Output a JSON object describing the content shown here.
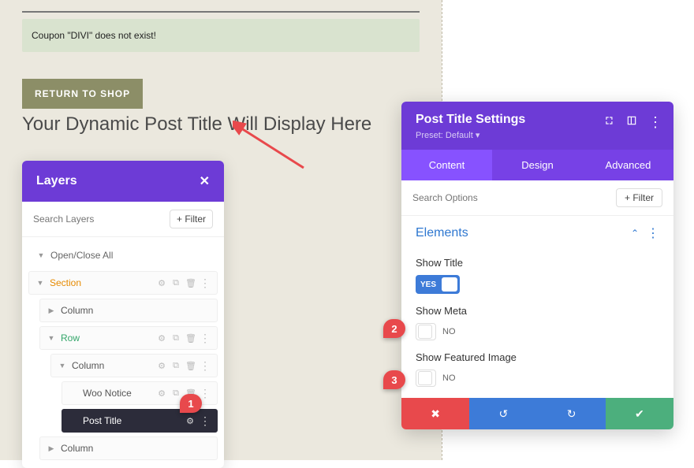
{
  "page": {
    "notice_text": "Coupon \"DIVI\" does not exist!",
    "return_button": "RETURN TO SHOP",
    "dynamic_title": "Your Dynamic Post Title Will Display Here"
  },
  "layers_panel": {
    "title": "Layers",
    "search_placeholder": "Search Layers",
    "filter_label": "+ Filter",
    "open_close": "Open/Close All",
    "tree": {
      "section": "Section",
      "column1": "Column",
      "row": "Row",
      "column2": "Column",
      "woo_notice": "Woo Notice",
      "post_title": "Post Title",
      "column3": "Column"
    }
  },
  "settings_panel": {
    "title": "Post Title Settings",
    "preset_label": "Preset: Default",
    "tabs": {
      "content": "Content",
      "design": "Design",
      "advanced": "Advanced"
    },
    "search_placeholder": "Search Options",
    "filter_label": "+  Filter",
    "section": {
      "header": "Elements",
      "show_title_label": "Show Title",
      "show_title_value": "YES",
      "show_meta_label": "Show Meta",
      "show_meta_value": "NO",
      "show_featured_image_label": "Show Featured Image",
      "show_featured_image_value": "NO"
    }
  },
  "markers": {
    "m1": "1",
    "m2": "2",
    "m3": "3"
  }
}
